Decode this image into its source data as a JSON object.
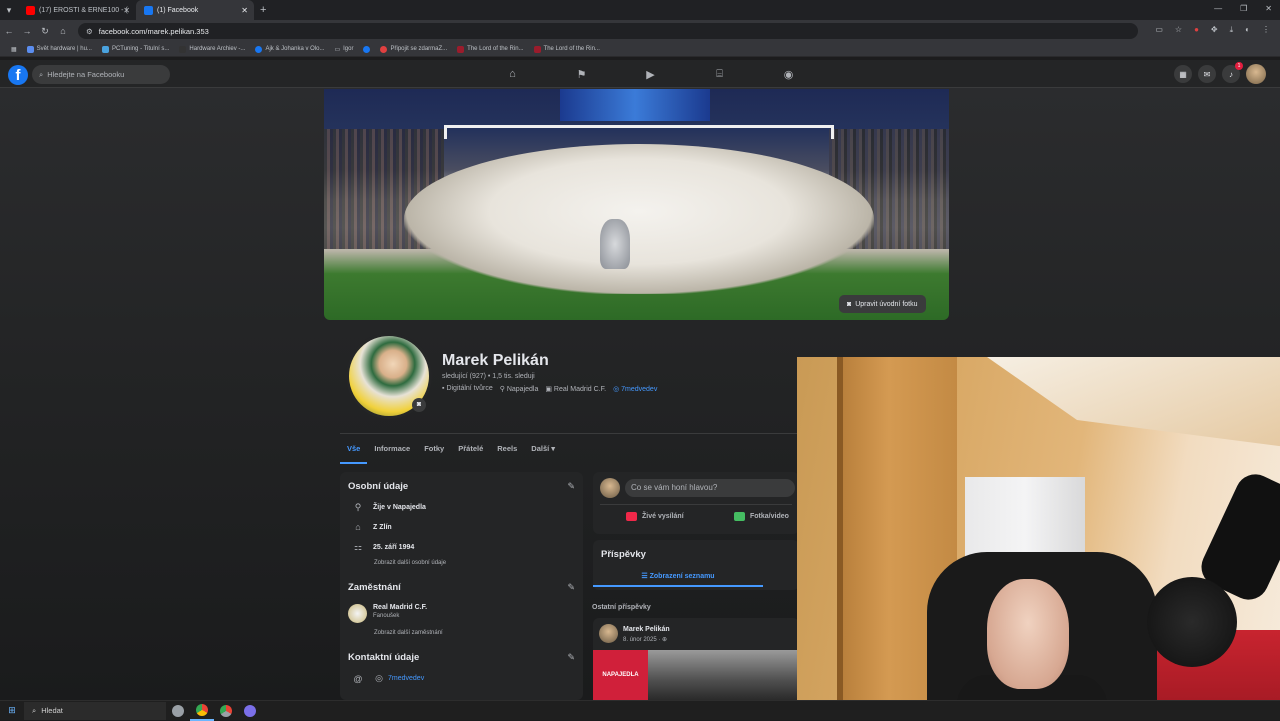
{
  "browser": {
    "tabs": [
      {
        "label": "(17) EROSTI & ERNE100 - (",
        "favicon_color": "#ff0000",
        "active": false
      },
      {
        "label": "(1) Facebook",
        "favicon_color": "#1877f2",
        "active": true
      }
    ],
    "new_tab": "+",
    "url": "facebook.com/marek.pelikan.353"
  },
  "bookmarks": [
    {
      "label": "Svět hardware | hu...",
      "color": "#5b8def"
    },
    {
      "label": "PCTuning - Titulní s...",
      "color": "#4aa3df"
    },
    {
      "label": "Hardware Archiev -...",
      "color": "#333333"
    },
    {
      "label": "Ajk & Johanka v Olo...",
      "color": "#1877f2"
    },
    {
      "label": "Igor",
      "color": "#b0b3b8"
    },
    {
      "label": "",
      "color": "#1877f2"
    },
    {
      "label": "Připojit se zdarmaZ...",
      "color": "#e04040"
    },
    {
      "label": "The Lord of the Rin...",
      "color": "#9b1c2c"
    },
    {
      "label": "The Lord of the Rin...",
      "color": "#9b1c2c"
    }
  ],
  "facebook": {
    "logo": "f",
    "search_placeholder": "Hledejte na Facebooku",
    "notification_count": "1"
  },
  "profile": {
    "edit_cover_label": "Upravit úvodní fotku",
    "name": "Marek Pelikán",
    "stats": "sledující (927) • 1,5 tis. sleduji",
    "meta": [
      "Digitální tvůrce",
      "Napajedla",
      "Real Madrid C.F.",
      "7medvedev"
    ],
    "tabs": [
      "Vše",
      "Informace",
      "Fotky",
      "Přátelé",
      "Reels",
      "Další ▾"
    ]
  },
  "personal": {
    "title": "Osobní údaje",
    "lives": "Žije v Napajedla",
    "from": "Z Zlín",
    "birthday": "25. září 1994",
    "more": "Zobrazit další osobní údaje"
  },
  "employment": {
    "title": "Zaměstnání",
    "company": "Real Madrid C.F.",
    "role": "Fanoušek",
    "more": "Zobrazit další zaměstnání"
  },
  "contact": {
    "title": "Kontaktní údaje",
    "instagram": "7medvedev"
  },
  "composer": {
    "placeholder": "Co se vám honí hlavou?",
    "live": "Živé vysílání",
    "photo": "Fotka/video"
  },
  "posts": {
    "title": "Příspěvky",
    "list_view": "☰ Zobrazení seznamu",
    "older": "Ostatní příspěvky",
    "item": {
      "author": "Marek Pelikán",
      "date": "8. únor 2025 · ",
      "image_text": "NAPAJEDLA"
    }
  },
  "taskbar": {
    "search": "Hledat"
  }
}
